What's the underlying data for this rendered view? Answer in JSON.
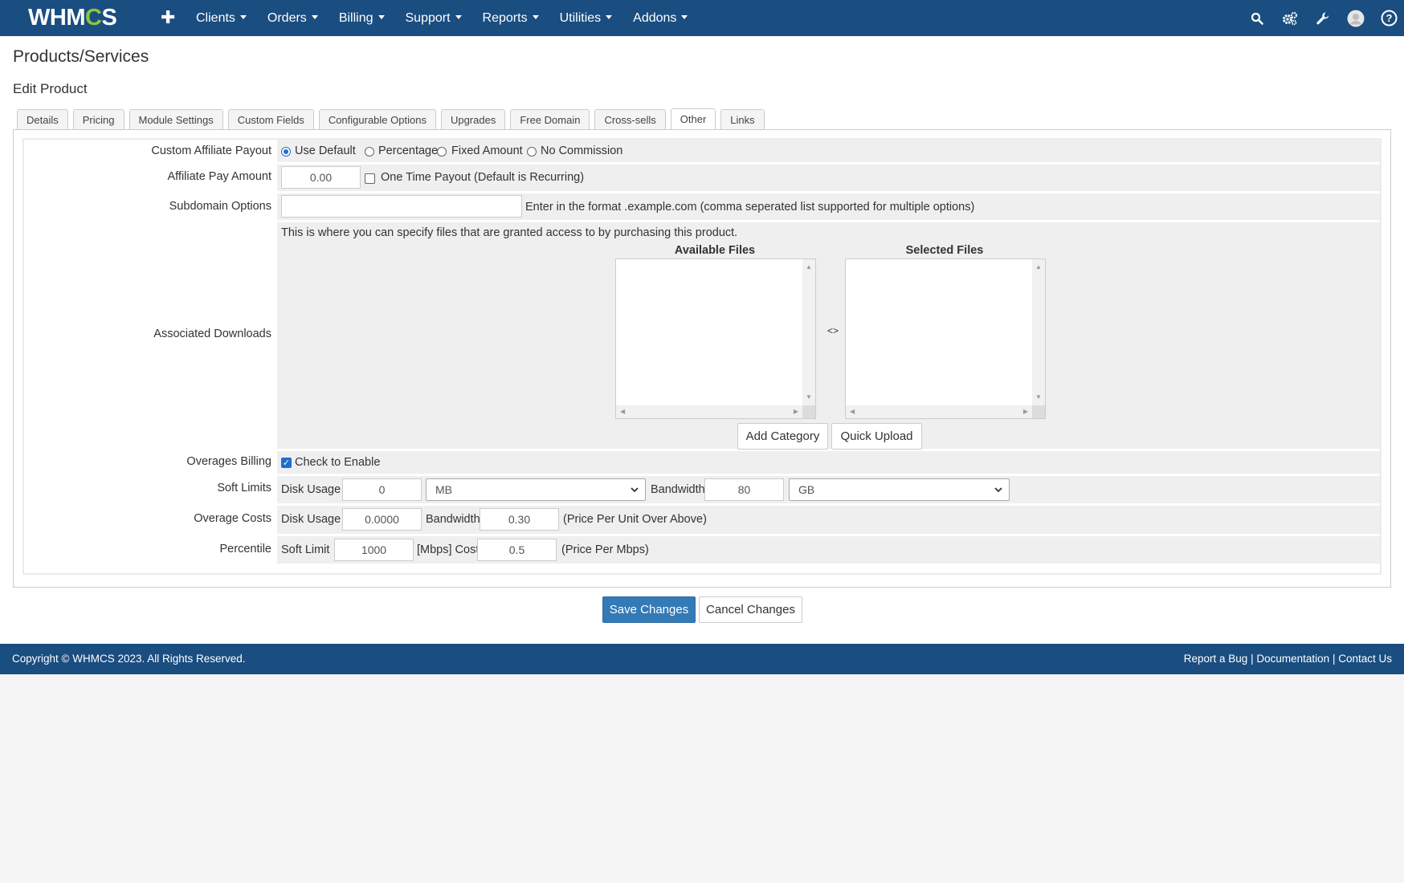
{
  "brand": {
    "logo_left": "WHM",
    "logo_gear": "C",
    "logo_right": "S"
  },
  "nav": {
    "items": [
      {
        "label": "Clients"
      },
      {
        "label": "Orders"
      },
      {
        "label": "Billing"
      },
      {
        "label": "Support"
      },
      {
        "label": "Reports"
      },
      {
        "label": "Utilities"
      },
      {
        "label": "Addons"
      }
    ],
    "icons": [
      "search-icon",
      "gears-icon",
      "wrench-icon",
      "user-avatar-icon",
      "help-icon"
    ]
  },
  "page": {
    "title": "Products/Services",
    "subtitle": "Edit Product"
  },
  "tabs": [
    "Details",
    "Pricing",
    "Module Settings",
    "Custom Fields",
    "Configurable Options",
    "Upgrades",
    "Free Domain",
    "Cross-sells",
    "Other",
    "Links"
  ],
  "active_tab": "Other",
  "form": {
    "affiliate_payout": {
      "label": "Custom Affiliate Payout",
      "options": [
        "Use Default",
        "Percentage",
        "Fixed Amount",
        "No Commission"
      ],
      "selected": "Use Default"
    },
    "affiliate_amount": {
      "label": "Affiliate Pay Amount",
      "value": "0.00",
      "onetime_label": "One Time Payout (Default is Recurring)"
    },
    "subdomain": {
      "label": "Subdomain Options",
      "value": "",
      "help": "Enter in the format .example.com (comma seperated list supported for multiple options)"
    },
    "downloads": {
      "label": "Associated Downloads",
      "help": "This is where you can specify files that are granted access to by purchasing this product.",
      "available_title": "Available Files",
      "selected_title": "Selected Files",
      "swap": "<>",
      "add_category": "Add Category",
      "quick_upload": "Quick Upload"
    },
    "overages": {
      "label": "Overages Billing",
      "check_label": "Check to Enable",
      "checked": true
    },
    "soft_limits": {
      "label": "Soft Limits",
      "disk_label": "Disk Usage",
      "disk_value": "0",
      "disk_unit": "MB",
      "bw_label": "Bandwidth",
      "bw_value": "80",
      "bw_unit": "GB"
    },
    "overage_costs": {
      "label": "Overage Costs",
      "disk_label": "Disk Usage",
      "disk_value": "0.0000",
      "bw_label": "Bandwidth",
      "bw_value": "0.30",
      "note": "(Price Per Unit Over Above)"
    },
    "percentile": {
      "label": "Percentile",
      "soft_label": "Soft Limit",
      "soft_value": "1000",
      "cost_label": "[Mbps] Cost",
      "cost_value": "0.5",
      "note": "(Price Per Mbps)"
    }
  },
  "actions": {
    "save": "Save Changes",
    "cancel": "Cancel Changes"
  },
  "footer": {
    "copyright": "Copyright © WHMCS 2023. All Rights Reserved.",
    "links": [
      "Report a Bug",
      "Documentation",
      "Contact Us"
    ],
    "separator": "|"
  },
  "colors": {
    "nav_bg": "#1a4d80",
    "primary": "#337ab7",
    "logo_gear": "#8cc63f"
  }
}
